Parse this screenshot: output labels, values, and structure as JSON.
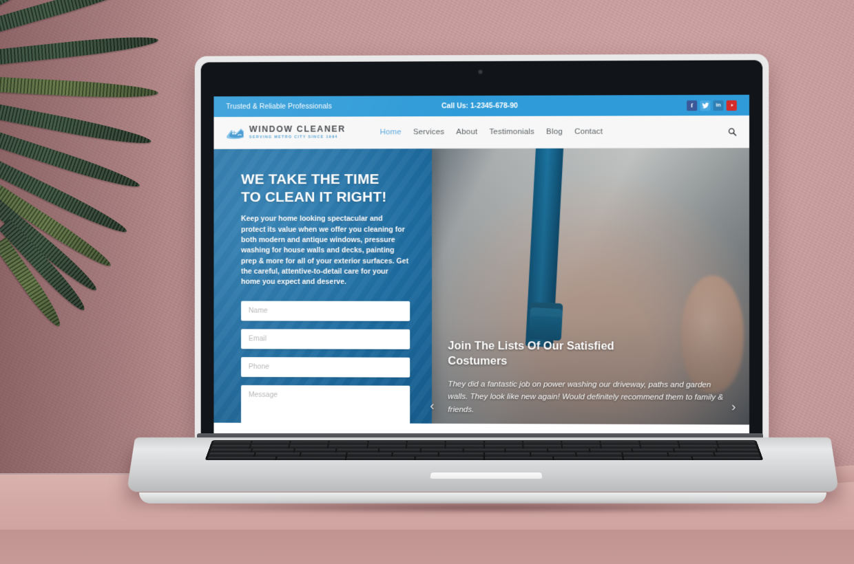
{
  "scene": {
    "device": "laptop",
    "background_description": "palm-plant-and-pink-wall",
    "colors": {
      "wall_pink": "#c59999",
      "table_pink": "#d3a8a4",
      "plant_green": "#37503a",
      "laptop_silver": "#e9e9ea",
      "bezel_black": "#111418"
    }
  },
  "site": {
    "colors": {
      "brand_blue": "#2f9bd8",
      "panel_blue": "#1d6b9f",
      "nav_active": "#59a8de",
      "nav_text": "#5a5f63",
      "facebook": "#3b5998",
      "twitter": "#4aa8e0",
      "linkedin": "#2f7fb5",
      "youtube": "#d42b2b"
    },
    "topbar": {
      "tagline": "Trusted & Reliable Professionals",
      "phone": "Call Us: 1-2345-678-90",
      "social": [
        {
          "name": "facebook",
          "icon": "facebook-icon",
          "glyph": "f"
        },
        {
          "name": "twitter",
          "icon": "twitter-icon",
          "glyph": ""
        },
        {
          "name": "linkedin",
          "icon": "linkedin-icon",
          "glyph": "in"
        },
        {
          "name": "youtube",
          "icon": "youtube-icon",
          "glyph": ""
        }
      ]
    },
    "header": {
      "logo_icon": "house-window-logo-icon",
      "logo_name": "WINDOW CLEANER",
      "logo_tagline": "SERVING METRO CITY SINCE 1994",
      "search_icon": "search-icon",
      "nav": [
        {
          "label": "Home",
          "active": true
        },
        {
          "label": "Services",
          "active": false
        },
        {
          "label": "About",
          "active": false
        },
        {
          "label": "Testimonials",
          "active": false
        },
        {
          "label": "Blog",
          "active": false
        },
        {
          "label": "Contact",
          "active": false
        }
      ]
    },
    "hero": {
      "headline_line1": "WE TAKE THE TIME",
      "headline_line2": "TO CLEAN IT RIGHT!",
      "paragraph": "Keep your home looking spectacular and protect its value when we offer you cleaning for both modern and antique windows, pressure washing for house walls and decks, painting prep & more for all of your exterior surfaces. Get the careful, attentive-to-detail care for your home you expect and deserve.",
      "form": {
        "name_placeholder": "Name",
        "email_placeholder": "Email",
        "phone_placeholder": "Phone",
        "message_placeholder": "Message",
        "name_value": "",
        "email_value": "",
        "phone_value": "",
        "message_value": ""
      }
    },
    "testimonial": {
      "heading_line1": "Join The Lists Of Our Satisfied",
      "heading_line2": "Costumers",
      "quote": "They did a fantastic job on power washing our driveway, paths and garden walls. They look like new again! Would definitely recommend them to family & friends.",
      "prev_icon": "chevron-left-icon",
      "next_icon": "chevron-right-icon",
      "prev_glyph": "‹",
      "next_glyph": "›"
    }
  }
}
